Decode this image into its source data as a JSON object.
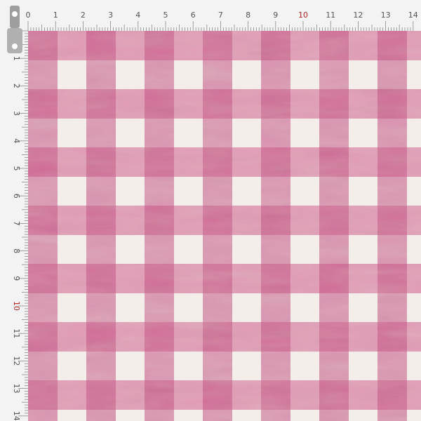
{
  "ruler": {
    "top_labels": [
      "0",
      "1",
      "2",
      "3",
      "4",
      "5",
      "6",
      "7",
      "8",
      "9",
      "10",
      "11",
      "12",
      "13",
      "14"
    ],
    "left_labels": [
      "1",
      "2",
      "3",
      "4",
      "5",
      "6",
      "7",
      "8",
      "9",
      "10",
      "11",
      "12",
      "13",
      "14"
    ],
    "label_color": "#555555",
    "accent_label": "10",
    "accent_color": "#b22222",
    "ruler_color": "#f3f3f3",
    "tick_color": "#8a8a8a"
  },
  "fabric": {
    "pattern": "gingham",
    "background_color": "#f3eeea",
    "stripe_color": "#d66a97",
    "overlap_color": "#c64d83"
  },
  "icons": {
    "ruler_hook": "ruler-hook-icon"
  }
}
